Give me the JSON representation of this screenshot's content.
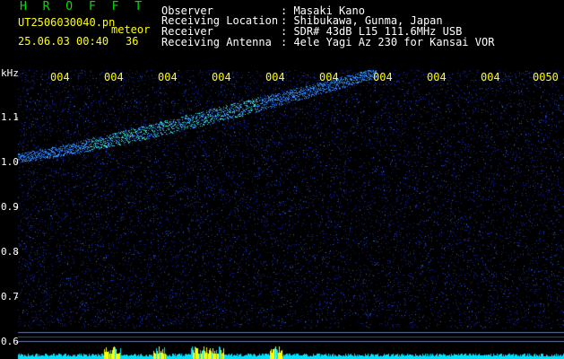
{
  "app": {
    "title": "H R O F F T"
  },
  "file": {
    "name": "UT2506030040.pn",
    "detector": "meteor",
    "timestamp": "25.06.03 00:40",
    "count": "36"
  },
  "info": [
    {
      "label": "Observer",
      "value": ": Masaki Kano"
    },
    {
      "label": "Receiving Location",
      "value": ": Shibukawa, Gunma, Japan"
    },
    {
      "label": "Receiver",
      "value": ": SDR# 43dB L15 111.6MHz USB"
    },
    {
      "label": "Receiving Antenna",
      "value": ": 4ele Yagi Az 230 for Kansai VOR"
    }
  ],
  "axis": {
    "unit": "kHz",
    "y_ticks": [
      "1.1",
      "1.0",
      "0.9",
      "0.8",
      "0.7",
      "0.6"
    ],
    "x_ticks": [
      "004",
      "004",
      "004",
      "004",
      "004",
      "004",
      "004",
      "004",
      "004",
      "0050"
    ]
  },
  "colors": {
    "background": "#000000",
    "noise": "#0a1a8a",
    "signal": "#40c0ff",
    "trace": "#40ffc0",
    "bars": "#00e0ff",
    "bars_peak": "#ffff00",
    "title": "#00e000"
  }
}
